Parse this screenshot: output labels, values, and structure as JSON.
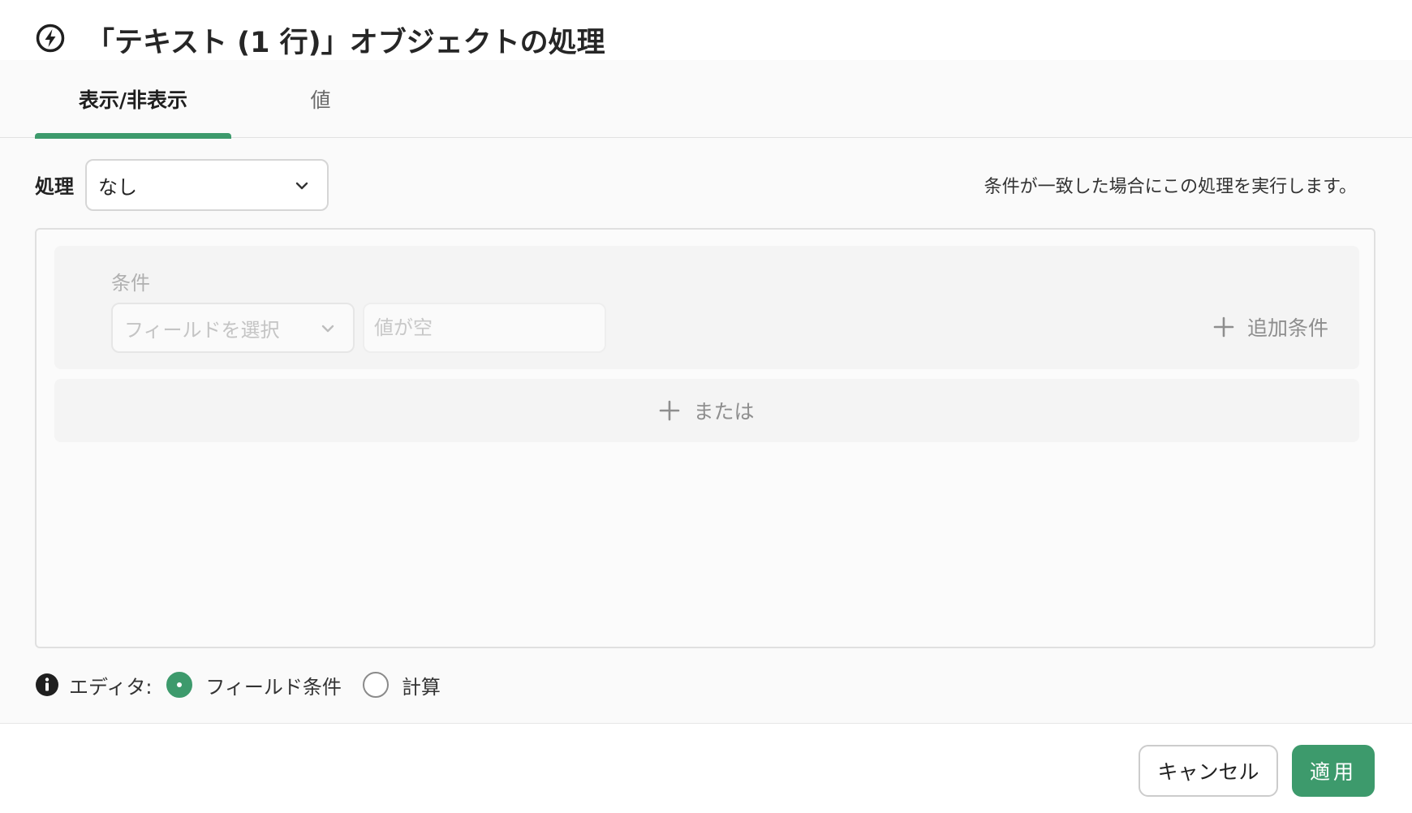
{
  "dialog": {
    "title": "「テキスト (1 行)」オブジェクトの処理",
    "icon": "lightning-bolt-icon"
  },
  "tabs": [
    {
      "label": "表示/非表示",
      "active": true
    },
    {
      "label": "値",
      "active": false
    }
  ],
  "action": {
    "label": "処理",
    "selected": "なし",
    "hint": "条件が一致した場合にこの処理を実行します。"
  },
  "conditions": {
    "label": "条件",
    "field_placeholder": "フィールドを選択",
    "value_placeholder": "値が空",
    "add_condition_label": "追加条件",
    "or_label": "または"
  },
  "editor": {
    "label": "エディタ:",
    "options": [
      {
        "label": "フィールド条件",
        "checked": true
      },
      {
        "label": "計算",
        "checked": false
      }
    ]
  },
  "footer": {
    "cancel_label": "キャンセル",
    "apply_label": "適用"
  },
  "colors": {
    "accent": "#3d9a6c"
  }
}
